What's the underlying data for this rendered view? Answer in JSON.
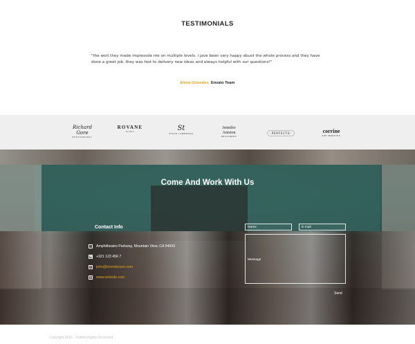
{
  "testimonials": {
    "title": "TESTIMONIALS",
    "quote": "\"the worl they made impressde me on multiple levels. i jave been very happy abuot the whole process and they have done a greet job. they was fast to delivery new ideas and always helpful with our questions!\"",
    "author_name": "Elena Gonzales",
    "author_team": "Envato Team"
  },
  "logos": [
    {
      "main": "Richard Gore",
      "sub": "PHOTOGRAPHY"
    },
    {
      "main": "ROVANE",
      "sub": "Studio"
    },
    {
      "main": "St",
      "sub": "STEVE LAWRENCE"
    },
    {
      "main": "Jennifer Aniston",
      "sub": "DESIGNERS"
    },
    {
      "main": "·PERFECTU·",
      "sub": ""
    },
    {
      "main": "corrine",
      "sub": "AND WEDDING"
    }
  ],
  "hero": {
    "title": "Come And Work With Us"
  },
  "contact": {
    "title": "Contact Info",
    "address": "Amphitheatre Parkway, Mountain View, CA 94043",
    "phone": "+321 123 456 7",
    "email": "john@loremipsum.com",
    "website": "www.website.com"
  },
  "form": {
    "name_placeholder": "Name",
    "email_placeholder": "E-mail",
    "message_placeholder": "Message",
    "send_label": "Send"
  },
  "footer": {
    "copyright": "Copyright 2016 - RattArt Rights Reserved"
  },
  "colors": {
    "accent": "#e6a21a",
    "logo_band": "#efefef"
  }
}
